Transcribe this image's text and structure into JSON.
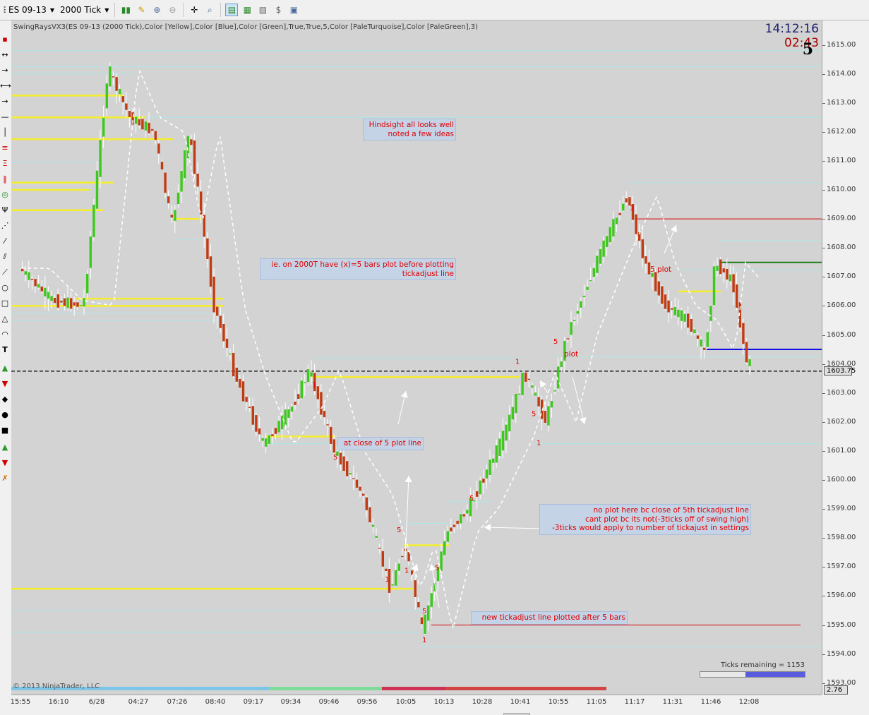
{
  "toolbar": {
    "instrument": "ES 09-13",
    "period": "2000 Tick"
  },
  "chart": {
    "header": "SwingRaysVX3(ES 09-13 (2000 Tick),Color [Yellow],Color [Blue],Color [Green],True,True,5,Color [PaleTurquoise],Color [PaleGreen],3)",
    "clock": "14:12:16",
    "timer": "02:43",
    "big_number": "5",
    "copyright": "© 2013 NinjaTrader, LLC",
    "ticks_remaining": "Ticks remaining = 1153",
    "ticks_remaining_fraction": 0.57,
    "last_price_label": "1603.75",
    "lower_tag": "2.76",
    "colors": {
      "background": "#d3d3d3",
      "up": "#3ec81e",
      "down": "#c03a12",
      "wick": "#ffffff",
      "yellow": "#f4ee2a",
      "cyan": "#aee6e6",
      "red": "#d80000",
      "blue": "#1010e6",
      "green": "#1a7a1a"
    }
  },
  "notes": {
    "hindsight": [
      "Hindsight all looks well",
      "noted a few ideas"
    ],
    "ie": [
      "ie. on 2000T have (x)=5 bars plot before plotting",
      "tickadjust line"
    ],
    "close5": "at close of 5 plot line",
    "noplot": [
      "no plot here bc close of 5th tickadjust line",
      "cant plot bc its not(-3ticks off of swing high)",
      "-3ticks would apply to number of tickajust in settings"
    ],
    "newline": "new tickadjust line plotted after 5 bars",
    "plot1": "plot",
    "plot2": "5 plot"
  },
  "bar_labels": {
    "one": "1",
    "five": "5"
  },
  "price_axis": {
    "ticks": [
      "1615.00",
      "1614.00",
      "1613.00",
      "1612.00",
      "1611.00",
      "1610.00",
      "1609.00",
      "1608.00",
      "1607.00",
      "1606.00",
      "1605.00",
      "1604.00",
      "1603.00",
      "1602.00",
      "1601.00",
      "1600.00",
      "1599.00",
      "1598.00",
      "1597.00",
      "1596.00",
      "1595.00",
      "1594.00",
      "1593.00"
    ]
  },
  "time_axis": {
    "ticks": [
      "15:55",
      "16:10",
      "6/28",
      "04:27",
      "07:26",
      "08:40",
      "09:17",
      "09:34",
      "09:46",
      "09:56",
      "10:05",
      "10:13",
      "10:28",
      "10:41",
      "10:55",
      "11:05",
      "11:17",
      "11:31",
      "11:46",
      "12:08"
    ]
  }
}
